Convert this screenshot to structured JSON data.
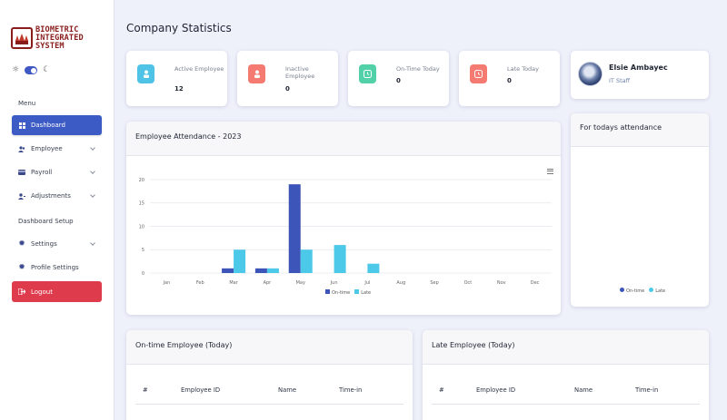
{
  "brand": {
    "line1": "BIOMETRIC",
    "line2": "INTEGRATED",
    "line3": "SYSTEM"
  },
  "theme": {
    "light_icon": "sun-icon",
    "dark_icon": "moon-icon",
    "dark_mode": true
  },
  "sidebar": {
    "menu_label": "Menu",
    "items": [
      {
        "label": "Dashboard",
        "icon": "grid-icon"
      },
      {
        "label": "Employee",
        "icon": "users-icon"
      },
      {
        "label": "Payroll",
        "icon": "card-icon"
      },
      {
        "label": "Adjustments",
        "icon": "user-adjust-icon"
      }
    ],
    "setup_label": "Dashboard Setup",
    "setup_items": [
      {
        "label": "Settings",
        "icon": "gear-icon"
      },
      {
        "label": "Profile Settings",
        "icon": "gear-icon"
      }
    ],
    "logout_label": "Logout"
  },
  "page": {
    "title": "Company Statistics"
  },
  "stats": [
    {
      "label": "Active Employee",
      "value": "12",
      "color": "#4fc3e6",
      "icon": "user-icon"
    },
    {
      "label": "Inactive Employee",
      "value": "0",
      "color": "#f57b72",
      "icon": "user-icon"
    },
    {
      "label": "On-Time Today",
      "value": "0",
      "color": "#52d1a8",
      "icon": "clock-icon"
    },
    {
      "label": "Late Today",
      "value": "0",
      "color": "#f57b72",
      "icon": "clock-icon"
    }
  ],
  "profile": {
    "name": "Elsie Ambayec",
    "role": "IT Staff"
  },
  "attendance_card": {
    "title": "Employee Attendance - 2023"
  },
  "todays_card": {
    "title": "For todays attendance",
    "legend": [
      "On-time",
      "Late"
    ]
  },
  "chart_data": {
    "type": "bar",
    "title": "",
    "categories": [
      "Jan",
      "Feb",
      "Mar",
      "Apr",
      "May",
      "Jun",
      "Jul",
      "Aug",
      "Sep",
      "Oct",
      "Nov",
      "Dec"
    ],
    "series": [
      {
        "name": "On-time",
        "color": "#3d54b8",
        "values": [
          0,
          0,
          1,
          1,
          19,
          0,
          0,
          0,
          0,
          0,
          0,
          0
        ]
      },
      {
        "name": "Late",
        "color": "#4cc8e8",
        "values": [
          0,
          0,
          5,
          1,
          5,
          6,
          2,
          0,
          0,
          0,
          0,
          0
        ]
      }
    ],
    "yticks": [
      "0",
      "5",
      "10",
      "15",
      "20"
    ],
    "ylim": [
      0,
      20
    ],
    "grid": true,
    "legend": "bottom"
  },
  "ontime_table": {
    "title": "On-time Employee (Today)",
    "columns": [
      "#",
      "Employee ID",
      "Name",
      "Time-in"
    ]
  },
  "late_table": {
    "title": "Late Employee (Today)",
    "columns": [
      "#",
      "Employee ID",
      "Name",
      "Time-in"
    ]
  }
}
